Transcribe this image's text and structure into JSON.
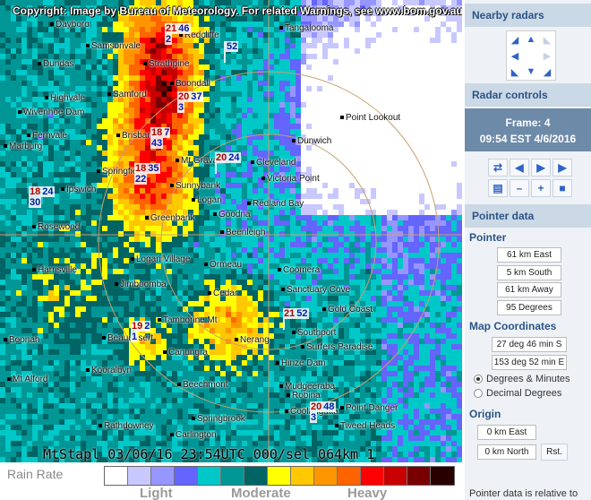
{
  "map": {
    "copyright": "Copyright: Image by Bureau of Meteorology. For related Warnings, see www.bom.gov.au",
    "footer": "MtStapl 03/06/16 23:54UTC 000/sel 064km  1",
    "places": [
      "Dayboro",
      "Redcliffe",
      "Tangalooma",
      "Samsonvale",
      "Dundas",
      "Strathpine",
      "Boondall",
      "Samford",
      "Highvale",
      "Wivenhoe Dam",
      "Point Lookout",
      "Brisbane",
      "Fernvale",
      "Mt Gravatt",
      "Dunwich",
      "Cleveland",
      "Victoria Point",
      "Marburg",
      "Ipswich",
      "Springfield",
      "Sunnybank",
      "Logan",
      "Redland Bay",
      "Beenleigh",
      "Greenbank",
      "Logan Village",
      "Harrisville",
      "Jimboomba",
      "Cedar",
      "Coomera",
      "Sanctuary Cove",
      "Beaudesert",
      "Canungra",
      "Tamborine Mt",
      "Nerang",
      "Southport",
      "Surfers Paradise",
      "Robina",
      "Hinze Dam",
      "Mudgeeraba",
      "Kooralbyn",
      "Mt Alford",
      "Beechmont",
      "Springbrook",
      "Coolangatta",
      "Point Danger",
      "Tweed Heads",
      "Rathdowney",
      "Carlington",
      "Boonah",
      "Ormeau",
      "Goodna",
      "Gold Coast",
      "Rosewood"
    ],
    "cells": [
      {
        "a": "21",
        "b": "46",
        "c": "2"
      },
      {
        "a": "",
        "b": "52",
        "c": ""
      },
      {
        "a": "20",
        "b": "37",
        "c": "3"
      },
      {
        "a": "18",
        "b": "7",
        "c": "43"
      },
      {
        "a": "20",
        "b": "24",
        "c": ""
      },
      {
        "a": "18",
        "b": "35",
        "c": "22"
      },
      {
        "a": "18",
        "b": "24",
        "c": "30"
      },
      {
        "a": "21",
        "b": "52",
        "c": ""
      },
      {
        "a": "19",
        "b": "2",
        "c": "1"
      },
      {
        "a": "20",
        "b": "48",
        "c": "3"
      }
    ]
  },
  "legend": {
    "title": "Rain Rate",
    "levels": [
      "Light",
      "Moderate",
      "Heavy"
    ],
    "colors": [
      "#ffffff",
      "#c8c8ff",
      "#9696ff",
      "#6464ff",
      "#00c8c8",
      "#009696",
      "#006464",
      "#ffff00",
      "#ffc800",
      "#ff9600",
      "#ff6400",
      "#ff0000",
      "#c80000",
      "#780000",
      "#280000"
    ]
  },
  "panel": {
    "nearby_title": "Nearby radars",
    "controls_title": "Radar controls",
    "frame_label": "Frame: 4",
    "frame_time": "09:54 EST 4/6/2016",
    "pointer_title": "Pointer data",
    "pointer_heading": "Pointer",
    "pointer_east": "61 km East",
    "pointer_south": "5 km South",
    "pointer_away": "61 km Away",
    "pointer_degrees": "95 Degrees",
    "map_coords_heading": "Map Coordinates",
    "lat": "27 deg 46 min S",
    "lon": "153 deg 52 min E",
    "radio_dm": "Degrees & Minutes",
    "radio_dd": "Decimal Degrees",
    "origin_heading": "Origin",
    "origin_east": "0 km East",
    "origin_north": "0 km North",
    "reset_label": "Rst.",
    "footer_note": "Pointer data is relative to"
  }
}
